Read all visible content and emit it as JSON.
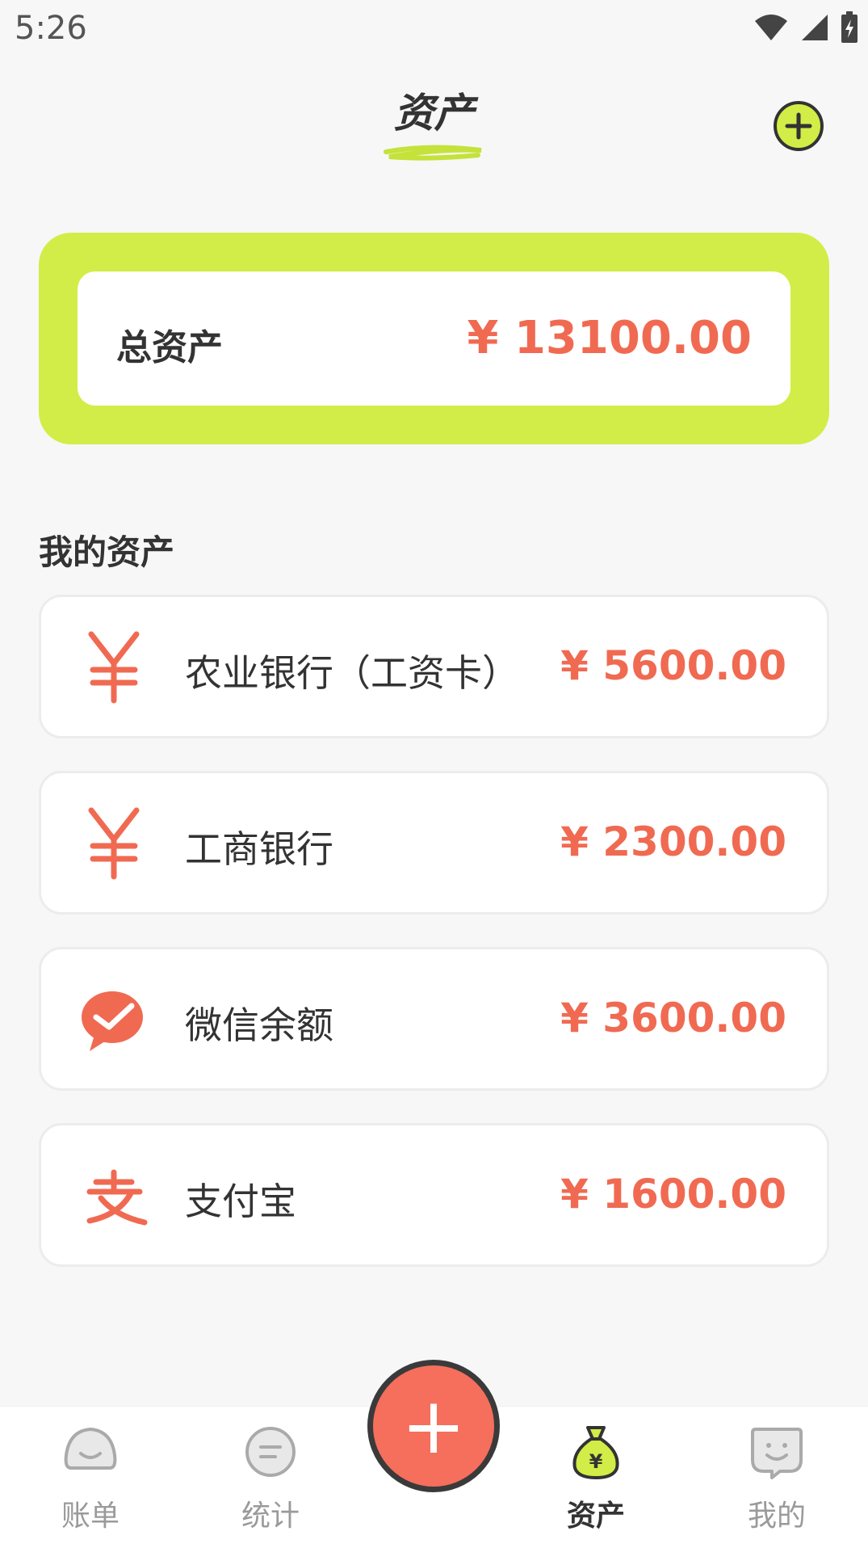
{
  "status_bar": {
    "time": "5:26",
    "icons": [
      "wifi-icon",
      "signal-icon",
      "battery-icon"
    ]
  },
  "header": {
    "title": "资产",
    "add_icon": "plus-circle-icon"
  },
  "total": {
    "label": "总资产",
    "amount": "¥ 13100.00"
  },
  "section": {
    "title": "我的资产"
  },
  "assets": [
    {
      "name": "农业银行（工资卡）",
      "amount": "¥ 5600.00",
      "icon": "yuan-icon"
    },
    {
      "name": "工商银行",
      "amount": "¥ 2300.00",
      "icon": "yuan-icon"
    },
    {
      "name": "微信余额",
      "amount": "¥ 3600.00",
      "icon": "wechat-icon"
    },
    {
      "name": "支付宝",
      "amount": "¥ 1600.00",
      "icon": "alipay-icon"
    }
  ],
  "bottom_nav": {
    "items": [
      {
        "label": "账单",
        "icon": "bill-icon",
        "active": false
      },
      {
        "label": "统计",
        "icon": "stats-icon",
        "active": false
      },
      {
        "label": "资产",
        "icon": "money-bag-icon",
        "active": true
      },
      {
        "label": "我的",
        "icon": "profile-icon",
        "active": false
      }
    ],
    "fab": "+"
  },
  "colors": {
    "accent": "#d2ed47",
    "amount": "#f06a52",
    "fab": "#f56f5c"
  }
}
